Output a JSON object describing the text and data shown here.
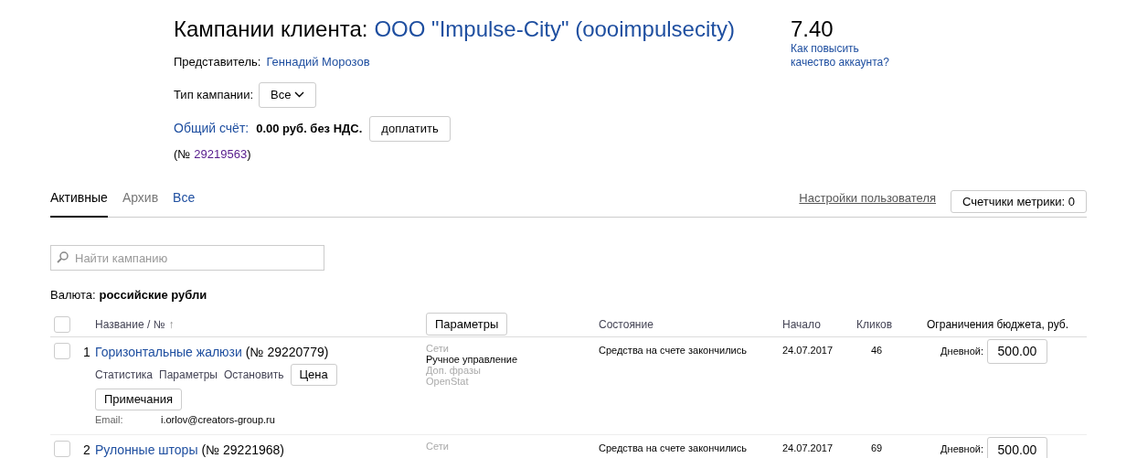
{
  "header": {
    "title": "Кампании клиента:",
    "client": "ООО \"Impulse-City\" (oooimpulsecity)",
    "representative_label": "Представитель:",
    "representative": "Геннадий Морозов",
    "campaign_type_label": "Тип кампании:",
    "campaign_type": "Все",
    "account_label": "Общий счёт:",
    "account_balance": "0.00 руб. без НДС.",
    "topup_button": "доплатить",
    "account_number_prefix": "(№",
    "account_number": "29219563",
    "account_number_suffix": ")"
  },
  "quality": {
    "score": "7.40",
    "link": "Как повысить качество аккаунта?"
  },
  "tabs": [
    {
      "label": "Активные",
      "selected": true,
      "disabled": false
    },
    {
      "label": "Архив",
      "selected": false,
      "disabled": true
    },
    {
      "label": "Все",
      "selected": false,
      "disabled": false
    }
  ],
  "user_settings_link": "Настройки пользователя",
  "metrics_button": "Счетчики метрики: 0",
  "search": {
    "placeholder": "Найти кампанию"
  },
  "currency": {
    "label": "Валюта:",
    "value": "российские рубли"
  },
  "table": {
    "select_all_checked": false,
    "columns": {
      "name": "Название / №",
      "sort_arrow": "↑",
      "params_button": "Параметры",
      "state": "Состояние",
      "start": "Начало",
      "clicks": "Кликов",
      "budget": "Ограничения бюджета, руб."
    },
    "rows": [
      {
        "checked": false,
        "index": "1",
        "name": "Горизонтальные жалюзи",
        "number": "(№ 29220779)",
        "actions": [
          "Статистика",
          "Параметры",
          "Остановить"
        ],
        "price_button": "Цена",
        "notes_button": "Примечания",
        "email_label": "Email:",
        "email": "i.orlov@creators-group.ru",
        "settings": [
          {
            "text": "Сети",
            "active": false
          },
          {
            "text": "Ручное управление",
            "active": true
          },
          {
            "text": "Доп. фразы",
            "active": false
          },
          {
            "text": "OpenStat",
            "active": false
          }
        ],
        "state": "Средства на счете закончились",
        "start": "24.07.2017",
        "clicks": "46",
        "budget_label": "Дневной:",
        "budget": "500.00"
      },
      {
        "checked": false,
        "index": "2",
        "name": "Рулонные шторы",
        "number": "(№ 29221968)",
        "actions": [],
        "settings": [
          {
            "text": "Сети",
            "active": false
          }
        ],
        "state": "Средства на счете закончились",
        "start": "24.07.2017",
        "clicks": "69",
        "budget_label": "Дневной:",
        "budget": "500.00"
      }
    ]
  }
}
